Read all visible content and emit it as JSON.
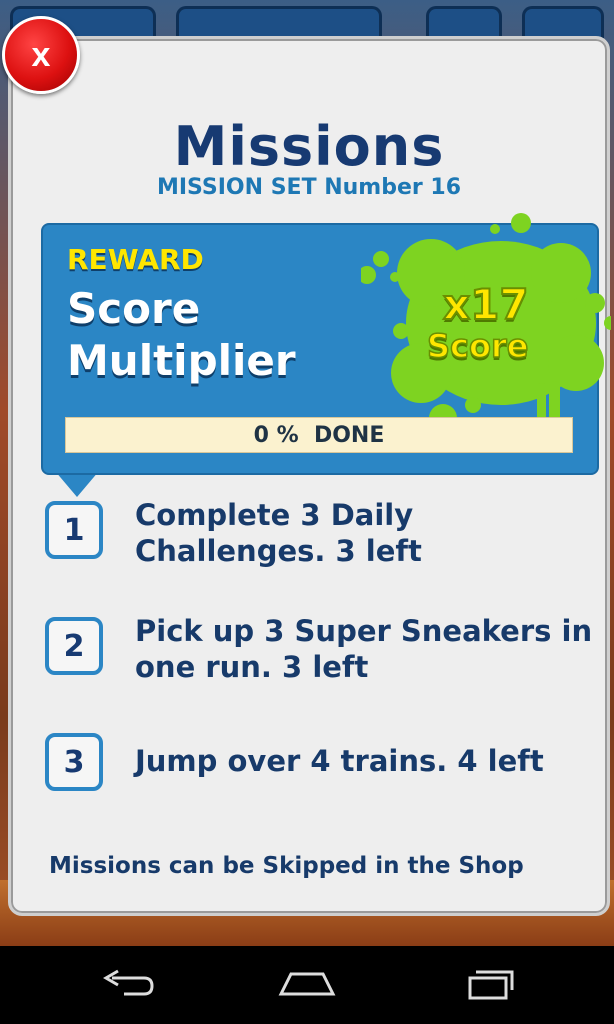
{
  "header": {
    "close_label": "x",
    "title": "Missions",
    "subtitle": "MISSION SET Number 16"
  },
  "reward": {
    "label": "REWARD",
    "name": "Score Multiplier",
    "multiplier": "x17",
    "multiplier_label": "Score",
    "progress_text": "0 %  DONE",
    "progress_percent": 0
  },
  "missions": [
    {
      "number": "1",
      "text": "Complete 3 Daily Challenges. 3 left"
    },
    {
      "number": "2",
      "text": "Pick up 3 Super Sneakers in one run. 3 left"
    },
    {
      "number": "3",
      "text": "Jump over 4 trains. 4 left"
    }
  ],
  "footer_note": "Missions can be Skipped in the Shop",
  "navbar": {
    "icons": [
      "back-icon",
      "home-icon",
      "recent-apps-icon"
    ]
  },
  "colors": {
    "title": "#173a72",
    "subtitle": "#1e78b4",
    "reward_bg": "#2b86c5",
    "reward_label": "#ffe600",
    "splat": "#7ed321",
    "close": "#d11111"
  }
}
